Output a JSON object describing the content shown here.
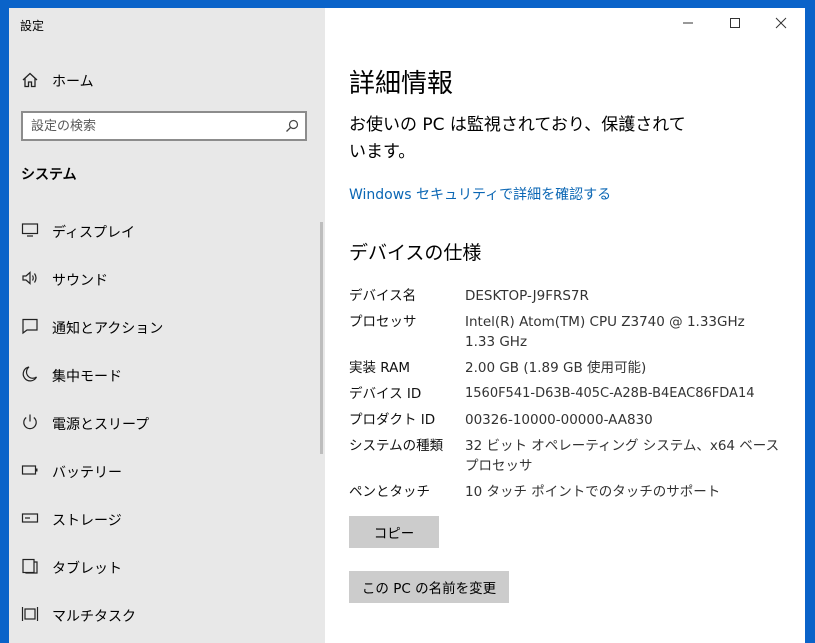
{
  "window": {
    "title": "設定",
    "controls": {
      "minimize": "minimize",
      "maximize": "maximize",
      "close": "close"
    }
  },
  "sidebar": {
    "home_label": "ホーム",
    "search": {
      "placeholder": "設定の検索"
    },
    "section_title": "システム",
    "items": [
      {
        "label": "ディスプレイ",
        "icon": "monitor-icon"
      },
      {
        "label": "サウンド",
        "icon": "speaker-icon"
      },
      {
        "label": "通知とアクション",
        "icon": "notification-icon"
      },
      {
        "label": "集中モード",
        "icon": "moon-icon"
      },
      {
        "label": "電源とスリープ",
        "icon": "power-icon"
      },
      {
        "label": "バッテリー",
        "icon": "battery-icon"
      },
      {
        "label": "ストレージ",
        "icon": "storage-icon"
      },
      {
        "label": "タブレット",
        "icon": "tablet-icon"
      },
      {
        "label": "マルチタスク",
        "icon": "multitask-icon"
      }
    ]
  },
  "main": {
    "title": "詳細情報",
    "protection_message": "お使いの PC は監視されており、保護されています。",
    "security_link": "Windows セキュリティで詳細を確認する",
    "specs_heading": "デバイスの仕様",
    "specs": [
      {
        "key": "デバイス名",
        "value": "DESKTOP-J9FRS7R"
      },
      {
        "key": "プロセッサ",
        "value": "Intel(R) Atom(TM) CPU  Z3740  @ 1.33GHz 1.33 GHz"
      },
      {
        "key": "実装 RAM",
        "value": "2.00 GB (1.89 GB 使用可能)"
      },
      {
        "key": "デバイス ID",
        "value": "1560F541-D63B-405C-A28B-B4EAC86FDA14"
      },
      {
        "key": "プロダクト ID",
        "value": "00326-10000-00000-AA830"
      },
      {
        "key": "システムの種類",
        "value": "32 ビット オペレーティング システム、x64 ベース プロセッサ"
      },
      {
        "key": "ペンとタッチ",
        "value": "10 タッチ ポイントでのタッチのサポート"
      }
    ],
    "copy_button": "コピー",
    "rename_button": "この PC の名前を変更"
  },
  "colors": {
    "desktop": "#0a63c9",
    "sidebar_bg": "#e8e8e8",
    "link": "#0a66b4",
    "button_bg": "#cccccc"
  }
}
